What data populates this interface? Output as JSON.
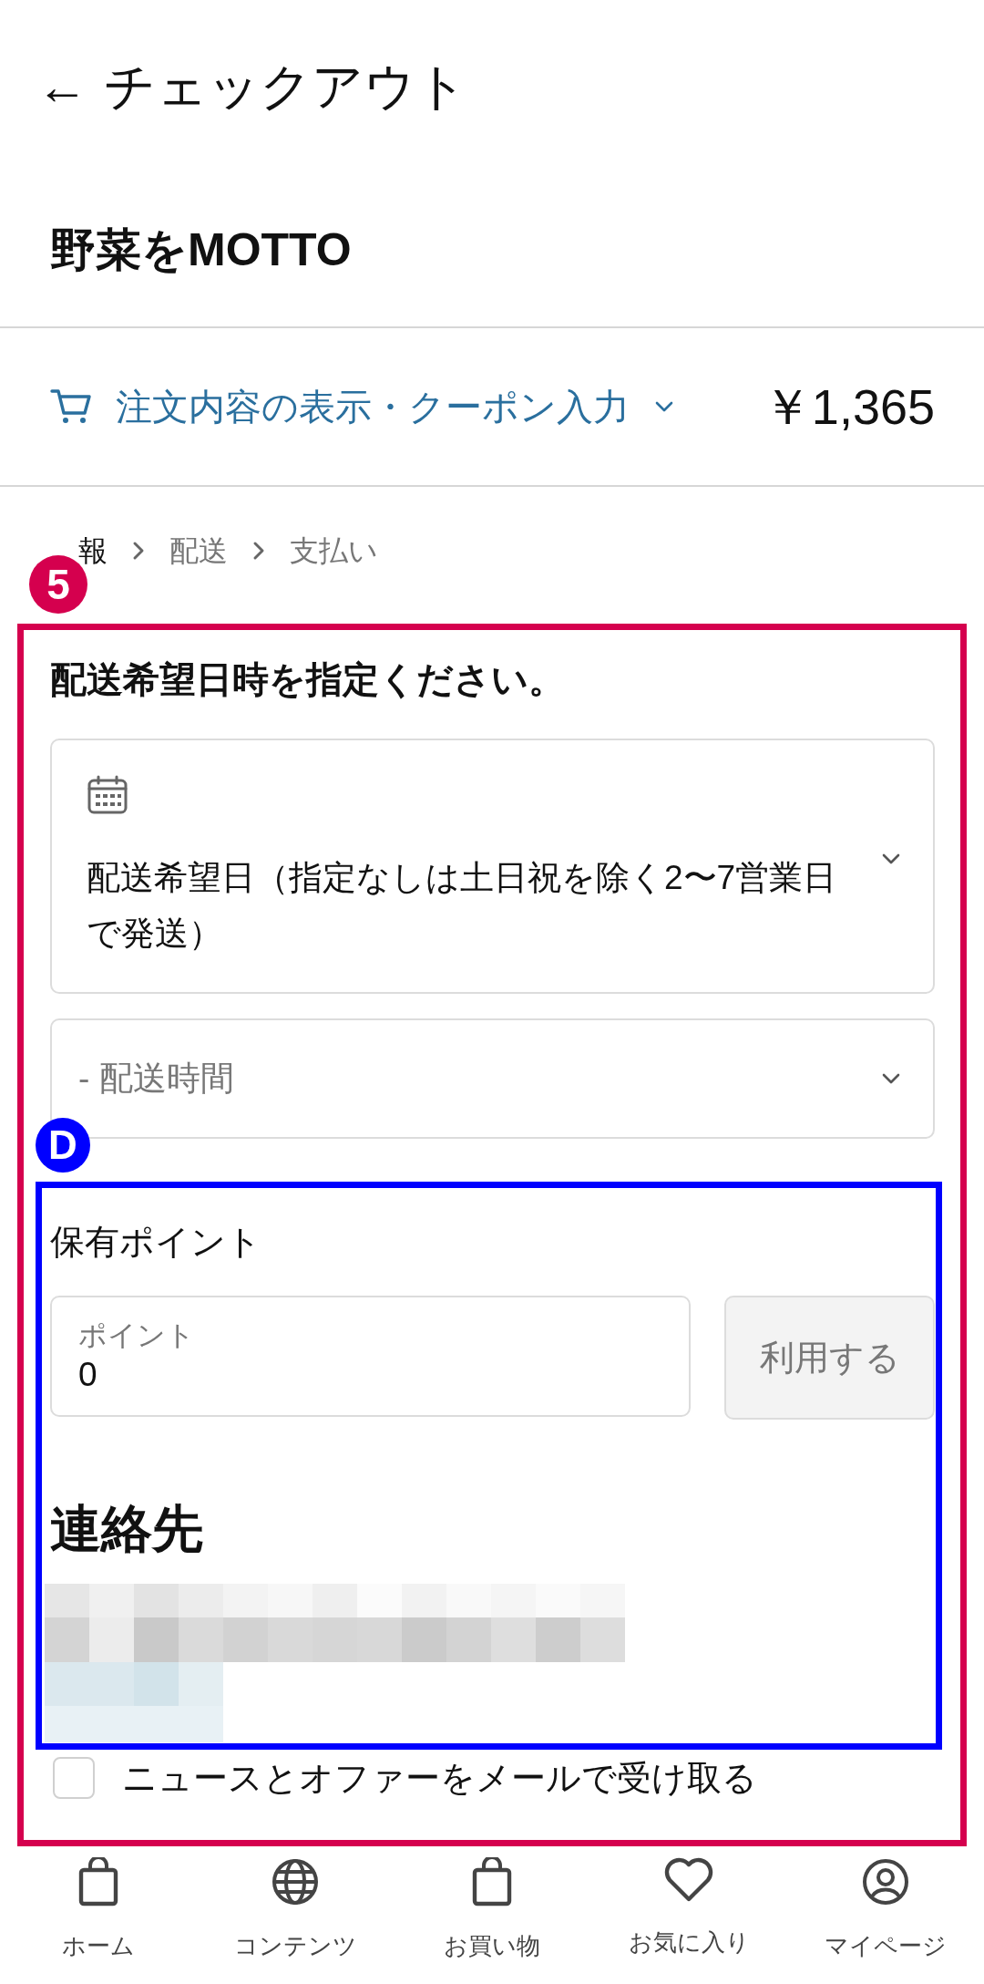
{
  "header": {
    "back": "←",
    "title": "チェックアウト"
  },
  "store_name": "野菜をMOTTO",
  "order_summary": {
    "label": "注文内容の表示・クーポン入力",
    "expanded": false,
    "price": "￥1,365"
  },
  "breadcrumb": [
    {
      "label": "報",
      "selected": true
    },
    {
      "label": "配送",
      "selected": false
    },
    {
      "label": "支払い",
      "selected": false
    }
  ],
  "delivery": {
    "heading": "配送希望日時を指定ください。",
    "date_select": {
      "value": "配送希望日（指定なしは土日祝を除く2〜7営業日で発送）"
    },
    "time_select": {
      "placeholder": "- 配送時間"
    }
  },
  "points": {
    "heading": "保有ポイント",
    "field_label": "ポイント",
    "value": "0",
    "button": "利用する"
  },
  "contact": {
    "heading": "連絡先"
  },
  "newsletter": {
    "label": "ニュースとオファーをメールで受け取る",
    "checked": false
  },
  "annotations": [
    {
      "label": "5",
      "color": "#d5004e"
    },
    {
      "label": "D",
      "color": "#0000ff"
    }
  ],
  "nav": [
    {
      "label": "ホーム",
      "kind": "bag"
    },
    {
      "label": "コンテンツ",
      "kind": "globe"
    },
    {
      "label": "お買い物",
      "kind": "bag"
    },
    {
      "label": "お気に入り",
      "kind": "heart"
    },
    {
      "label": "マイページ",
      "kind": "user"
    }
  ]
}
